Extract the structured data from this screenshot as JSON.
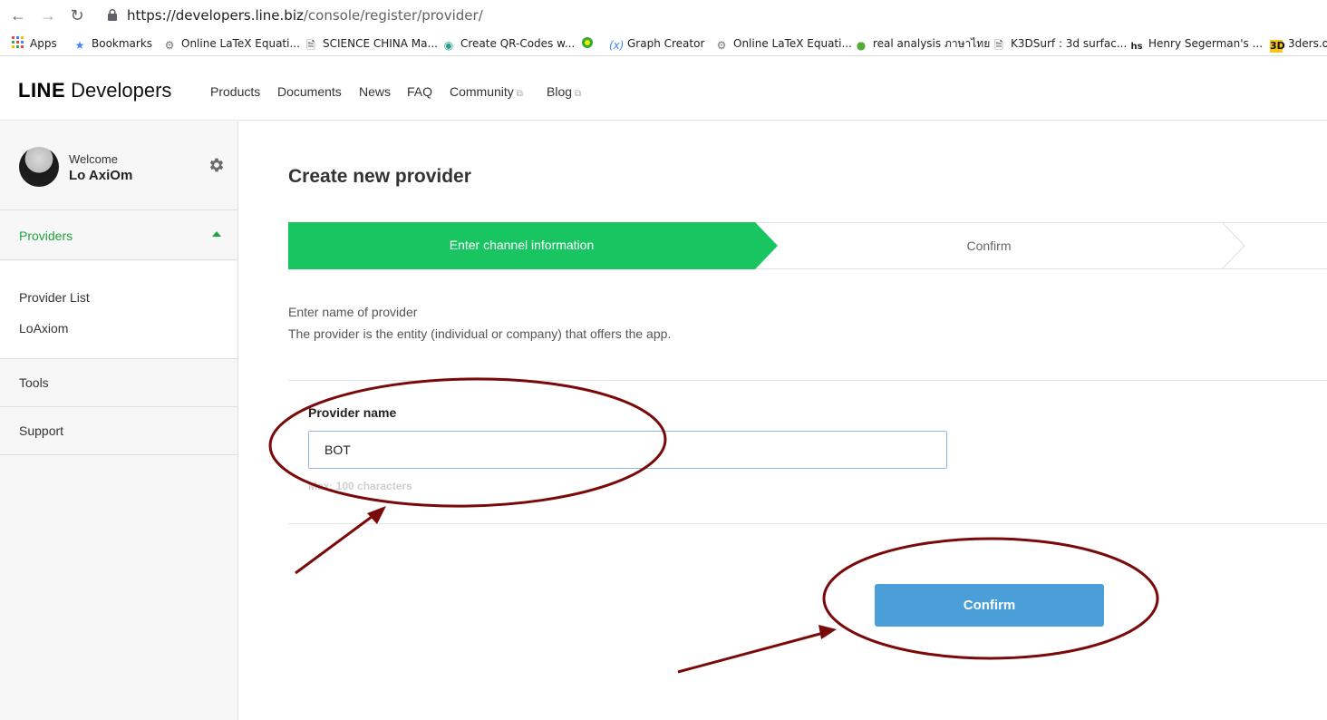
{
  "browser": {
    "url_host": "https://developers.line.biz",
    "url_path": "/console/register/provider/",
    "bookmarks": [
      {
        "label": "Apps",
        "icon": "apps-grid-icon"
      },
      {
        "label": "Bookmarks",
        "icon": "star-icon"
      },
      {
        "label": "Online LaTeX Equati...",
        "icon": "gear-icon"
      },
      {
        "label": "SCIENCE CHINA Ma...",
        "icon": "page-icon"
      },
      {
        "label": "Create QR-Codes w...",
        "icon": "qr-icon"
      },
      {
        "label": "",
        "icon": "circle-icon"
      },
      {
        "label": "Graph Creator",
        "icon": "fx-icon"
      },
      {
        "label": "Online LaTeX Equati...",
        "icon": "gear-icon"
      },
      {
        "label": "real analysis ภาษาไทย",
        "icon": "site-icon"
      },
      {
        "label": "K3DSurf : 3d surfac...",
        "icon": "page-icon"
      },
      {
        "label": "Henry Segerman's ...",
        "icon": "hs-icon"
      },
      {
        "label": "3ders.o",
        "icon": "3d-icon"
      }
    ]
  },
  "header": {
    "logo_bold": "LINE",
    "logo_text": "Developers",
    "nav": [
      "Products",
      "Documents",
      "News",
      "FAQ",
      "Community",
      "Blog"
    ]
  },
  "sidebar": {
    "welcome": "Welcome",
    "username": "Lo AxiOm",
    "providers_label": "Providers",
    "sub_items": [
      "Provider List",
      "LoAxiom"
    ],
    "items": [
      "Tools",
      "Support"
    ]
  },
  "main": {
    "title": "Create new provider",
    "steps": [
      "Enter channel information",
      "Confirm"
    ],
    "description_line1": "Enter name of provider",
    "description_line2": "The provider is the entity (individual or company) that offers the app.",
    "field_label": "Provider name",
    "field_value": "BOT",
    "field_hint": "Max: 100 characters",
    "confirm_label": "Confirm"
  },
  "colors": {
    "accent_green": "#19c560",
    "button_blue": "#4a9fd8",
    "annotation_red": "#7a0a0a"
  }
}
